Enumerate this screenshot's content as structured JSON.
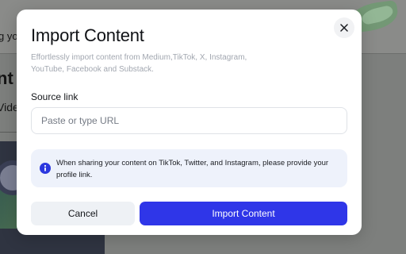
{
  "background": {
    "partial_texts": [
      "g you",
      "nt",
      "Video"
    ]
  },
  "modal": {
    "title": "Import Content",
    "subtitle": "Effortlessly import content from Medium,TikTok, X, Instagram, YouTube, Facebook and Substack.",
    "close_icon": "close-icon",
    "source": {
      "label": "Source link",
      "placeholder": "Paste or type URL",
      "value": ""
    },
    "info": {
      "icon": "info-icon",
      "text": "When sharing your content on TikTok, Twitter, and Instagram, please provide your profile link."
    },
    "buttons": {
      "cancel": "Cancel",
      "import": "Import Content"
    }
  },
  "colors": {
    "primary": "#2f36e8",
    "info_bg": "#eef2fb",
    "overlay": "#7d7f7d"
  }
}
